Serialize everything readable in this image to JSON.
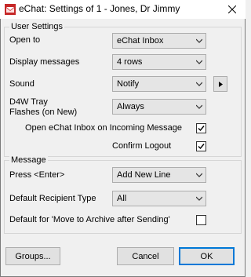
{
  "window": {
    "title": "eChat: Settings of 1 - Jones, Dr Jimmy",
    "app_icon": "echat-app-icon",
    "close_icon": "close-icon"
  },
  "user_settings": {
    "group_label": "User Settings",
    "open_to": {
      "label": "Open to",
      "value": "eChat Inbox"
    },
    "display_messages": {
      "label": "Display messages",
      "value": "4 rows"
    },
    "sound": {
      "label": "Sound",
      "value": "Notify",
      "play_icon": "play-icon"
    },
    "tray_flashes": {
      "label_line1": "D4W Tray",
      "label_line2": "Flashes (on New)",
      "value": "Always"
    },
    "open_inbox_on_incoming": {
      "label": "Open eChat Inbox on Incoming Message",
      "checked": true
    },
    "confirm_logout": {
      "label": "Confirm Logout",
      "checked": true
    }
  },
  "message": {
    "group_label": "Message",
    "press_enter": {
      "label": "Press <Enter>",
      "value": "Add New Line"
    },
    "default_recipient_type": {
      "label": "Default Recipient Type",
      "value": "All"
    },
    "move_to_archive": {
      "label": "Default for 'Move to Archive after Sending'",
      "checked": false
    }
  },
  "buttons": {
    "groups": "Groups...",
    "cancel": "Cancel",
    "ok": "OK"
  }
}
